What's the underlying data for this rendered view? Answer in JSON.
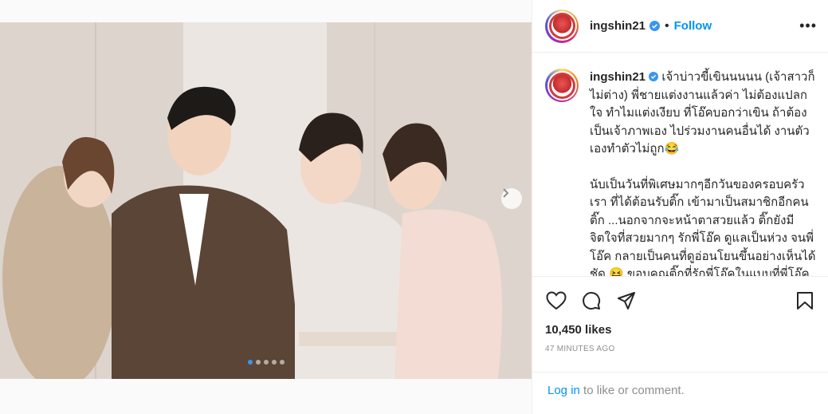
{
  "post": {
    "username": "ingshin21",
    "follow_label": "Follow",
    "more_label": "•••",
    "caption_p1": "เจ้าบ่าวขี้เขินนนนน (เจ้าสาวก็ไม่ต่าง) พี่ชายแต่งงานแล้วค่า ไม่ต้องแปลกใจ ทำไมแต่งเงียบ ที่โอ๊คบอกว่าเขิน ถ้าต้องเป็นเจ้าภาพเอง ไปร่วมงานคนอื่นได้ งานตัวเองทำตัวไม่ถูก😂",
    "caption_p2": "นับเป็นวันที่พิเศษมากๆอีกวันของครอบครัวเรา ที่ได้ต้อนรับติ๊ก เข้ามาเป็นสมาชิกอีกคน ติ๊ก ...นอกจากจะหน้าตาสวยแล้ว ติ๊กยังมีจิตใจที่สวยมากๆ รักพี่โอ๊ค ดูแลเป็นห่วง จนพี่โอ๊ค กลายเป็นคนที่ดูอ่อนโยนขึ้นอย่างเห็นได้ชัด 😝 ขอบคุณติ๊กที่รักพี่โอ๊คในแบบที่พี่โอ๊คเป็น และยังช่วยดูแลพี่โอ๊คให้ดีขึ้น ❤️",
    "likes": "10,450 likes",
    "timestamp": "47 MINUTES AGO",
    "login_link": "Log in",
    "login_rest": " to like or comment."
  },
  "carousel": {
    "slide_count": 5,
    "active_index": 0
  },
  "icons": {
    "verified": "verified-badge-icon",
    "like": "heart-icon",
    "comment": "comment-icon",
    "share": "share-icon",
    "save": "bookmark-icon",
    "next": "chevron-right-icon"
  },
  "colors": {
    "accent": "#0095f6",
    "text": "#262626",
    "muted": "#8e8e8e",
    "verified": "#3897f0"
  }
}
